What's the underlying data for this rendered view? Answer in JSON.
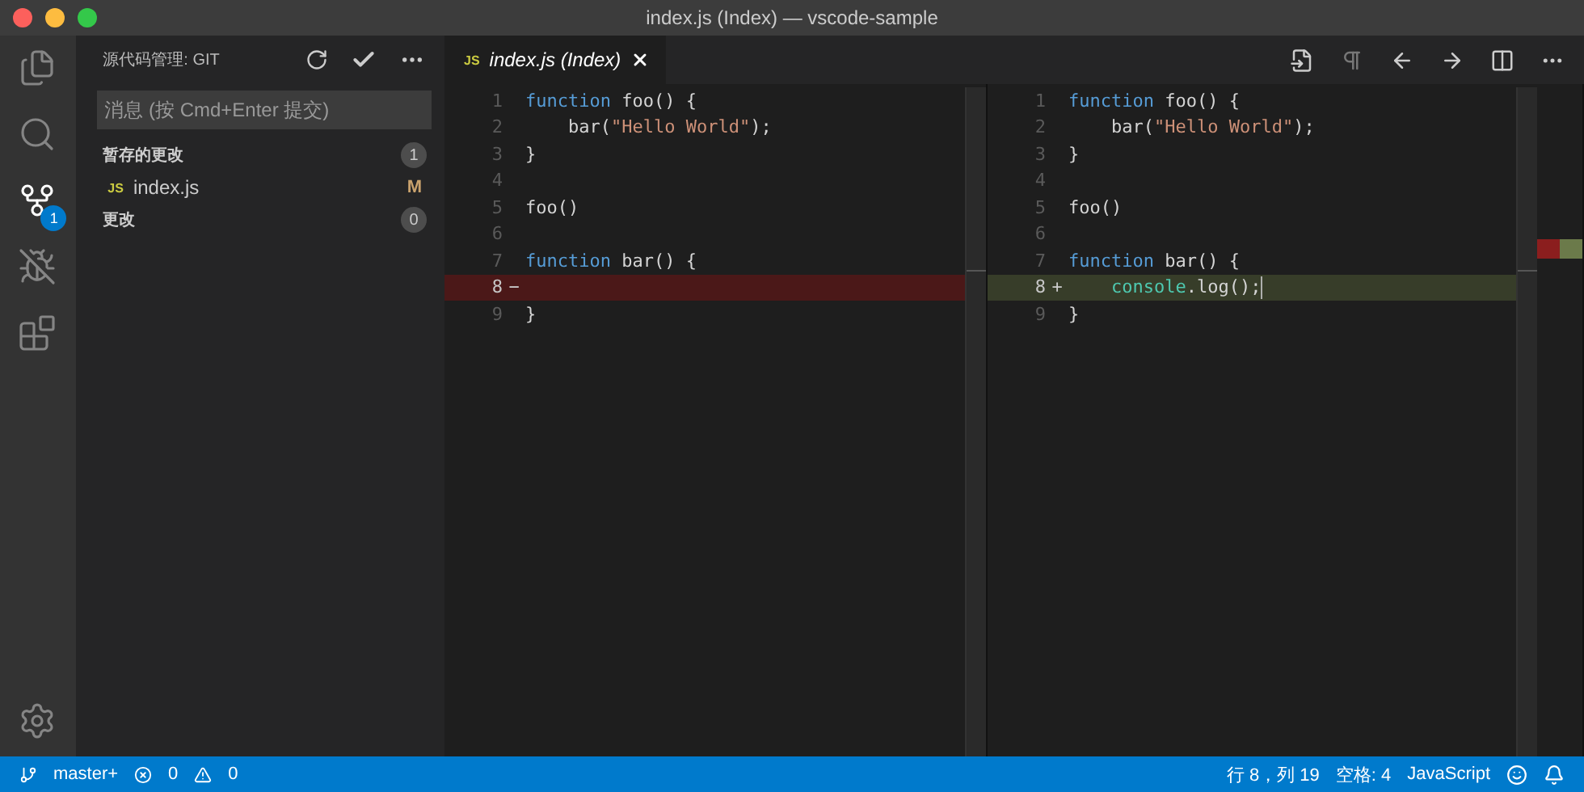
{
  "window": {
    "title": "index.js (Index) — vscode-sample"
  },
  "activity_bar": [
    {
      "kind": "files",
      "selected": false
    },
    {
      "kind": "search",
      "selected": false
    },
    {
      "kind": "scm",
      "selected": true,
      "badge": "1"
    },
    {
      "kind": "debug",
      "selected": false
    },
    {
      "kind": "extensions",
      "selected": false
    },
    {
      "kind": "settings",
      "selected": false
    }
  ],
  "sidebar": {
    "title": "源代码管理: GIT",
    "commit_placeholder": "消息 (按 Cmd+Enter 提交)",
    "groups": [
      {
        "label": "暂存的更改",
        "count": "1",
        "files": [
          {
            "badge": "JS",
            "name": "index.js",
            "status": "M"
          }
        ]
      },
      {
        "label": "更改",
        "count": "0"
      }
    ]
  },
  "tab": {
    "badge": "JS",
    "label": "index.js (Index)"
  },
  "panes": [
    {
      "lines": [
        {
          "number": "1",
          "kind": "normal",
          "tokens": [
            {
              "t": "function",
              "kind": "keyword"
            },
            {
              "t": " foo() {",
              "kind": "plain"
            }
          ]
        },
        {
          "number": "2",
          "kind": "normal",
          "indented": true,
          "tokens": [
            {
              "t": "bar(",
              "kind": "plain"
            },
            {
              "t": "\"Hello World\"",
              "kind": "string"
            },
            {
              "t": ");",
              "kind": "plain"
            }
          ]
        },
        {
          "number": "3",
          "kind": "normal",
          "tokens": [
            {
              "t": "}",
              "kind": "plain"
            }
          ]
        },
        {
          "number": "4",
          "kind": "normal"
        },
        {
          "number": "5",
          "kind": "normal",
          "tokens": [
            {
              "t": "foo()",
              "kind": "plain"
            }
          ]
        },
        {
          "number": "6",
          "kind": "normal"
        },
        {
          "number": "7",
          "kind": "normal",
          "tokens": [
            {
              "t": "function",
              "kind": "keyword"
            },
            {
              "t": " bar() {",
              "kind": "plain"
            }
          ]
        },
        {
          "number": "8",
          "kind": "removed",
          "marker": "−"
        },
        {
          "number": "9",
          "kind": "normal",
          "tokens": [
            {
              "t": "}",
              "kind": "plain"
            }
          ]
        }
      ]
    },
    {
      "lines": [
        {
          "number": "1",
          "kind": "normal",
          "tokens": [
            {
              "t": "function",
              "kind": "keyword"
            },
            {
              "t": " foo() {",
              "kind": "plain"
            }
          ]
        },
        {
          "number": "2",
          "kind": "normal",
          "indented": true,
          "tokens": [
            {
              "t": "bar(",
              "kind": "plain"
            },
            {
              "t": "\"Hello World\"",
              "kind": "string"
            },
            {
              "t": ");",
              "kind": "plain"
            }
          ]
        },
        {
          "number": "3",
          "kind": "normal",
          "tokens": [
            {
              "t": "}",
              "kind": "plain"
            }
          ]
        },
        {
          "number": "4",
          "kind": "normal"
        },
        {
          "number": "5",
          "kind": "normal",
          "tokens": [
            {
              "t": "foo()",
              "kind": "plain"
            }
          ]
        },
        {
          "number": "6",
          "kind": "normal"
        },
        {
          "number": "7",
          "kind": "normal",
          "tokens": [
            {
              "t": "function",
              "kind": "keyword"
            },
            {
              "t": " bar() {",
              "kind": "plain"
            }
          ]
        },
        {
          "number": "8",
          "kind": "added",
          "marker": "+",
          "cursor": true,
          "indented": true,
          "tokens": [
            {
              "t": "console",
              "kind": "type"
            },
            {
              "t": ".log();",
              "kind": "plain"
            }
          ]
        },
        {
          "number": "9",
          "kind": "normal",
          "tokens": [
            {
              "t": "}",
              "kind": "plain"
            }
          ]
        }
      ]
    }
  ],
  "status_bar": {
    "branch": "master+",
    "errors": "0",
    "warnings": "0",
    "position": "行 8，列 19",
    "indent": "空格: 4",
    "language": "JavaScript"
  }
}
